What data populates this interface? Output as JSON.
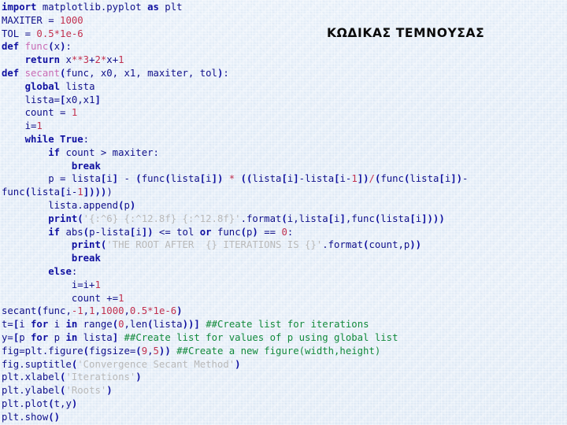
{
  "slide": {
    "background_color": "#dfe9f6",
    "heading": "ΚΩΔΙΚΑΣ ΤΕΜΝΟΥΣΑΣ"
  },
  "palette": {
    "keyword": "#0f10a0",
    "identifier": "#10108a",
    "number": "#c1304f",
    "string": "#b9b9b9",
    "comment": "#128a3c",
    "function_name": "#c96bb5",
    "bracket": "#0f10a0",
    "heading_text": "#0a0a0a"
  },
  "code": {
    "language": "python",
    "lines": [
      "import matplotlib.pyplot as plt",
      "MAXITER = 1000",
      "TOL = 0.5*1e-6",
      "def func(x):",
      "    return x**3+2*x+1",
      "def secant(func, x0, x1, maxiter, tol):",
      "    global lista",
      "    lista=[x0,x1]",
      "    count = 1",
      "    i=1",
      "    while True:",
      "        if count > maxiter:",
      "            break",
      "        p = lista[i] - (func(lista[i]) * ((lista[i]-lista[i-1])/(func(lista[i])-",
      "func(lista[i-1]))))",
      "        lista.append(p)",
      "        print('{:^6} {:^12.8f} {:^12.8f}'.format(i,lista[i],func(lista[i])))",
      "        if abs(p-lista[i]) <= tol or func(p) == 0:",
      "            print('THE ROOT AFTER  {} ITERATIONS IS {}'.format(count,p))",
      "            break",
      "        else:",
      "            i=i+1",
      "            count +=1",
      "secant(func,-1,1,1000,0.5*1e-6)",
      "t=[i for i in range(0,len(lista))] ##Create list for iterations",
      "y=[p for p in lista] ##Create list for values of p using global list",
      "fig=plt.figure(figsize=(9,5)) ##Create a new figure(width,height)",
      "fig.suptitle('Convergence Secant Method')",
      "plt.xlabel('Iterations')",
      "plt.ylabel('Roots')",
      "plt.plot(t,y)",
      "plt.show()"
    ]
  }
}
